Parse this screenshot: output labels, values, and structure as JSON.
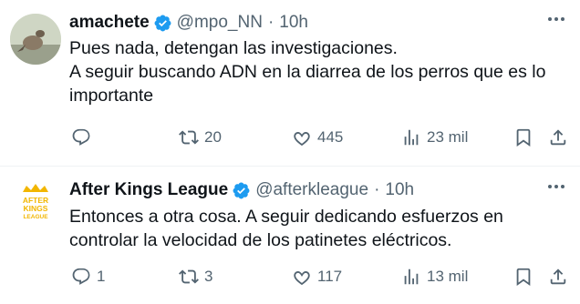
{
  "tweets": [
    {
      "author": {
        "name": "amachete",
        "handle": "@mpo_NN",
        "time": "10h"
      },
      "text_lines": [
        "Pues nada, detengan las investigaciones.",
        "A seguir buscando ADN en la diarrea de los perros que es lo importante"
      ],
      "stats": {
        "replies": "",
        "reposts": "20",
        "likes": "445",
        "views": "23 mil"
      }
    },
    {
      "author": {
        "name": "After Kings League",
        "handle": "@afterkleague",
        "time": "10h",
        "avatar_text": [
          "AFTER",
          "KINGS",
          "LEAGUE"
        ]
      },
      "text_lines": [
        "Entonces a otra cosa. A seguir dedicando esfuerzos en controlar la velocidad de los patinetes eléctricos."
      ],
      "stats": {
        "replies": "1",
        "reposts": "3",
        "likes": "117",
        "views": "13 mil"
      }
    }
  ],
  "colors": {
    "verified": "#1d9bf0",
    "secondary_text": "#536471",
    "primary_text": "#0f1419",
    "divider": "#eff3f4",
    "kings_gold": "#f2b600"
  },
  "icons": [
    "verified-badge-icon",
    "more-icon",
    "reply-icon",
    "repost-icon",
    "like-icon",
    "views-icon",
    "bookmark-icon",
    "share-icon"
  ]
}
